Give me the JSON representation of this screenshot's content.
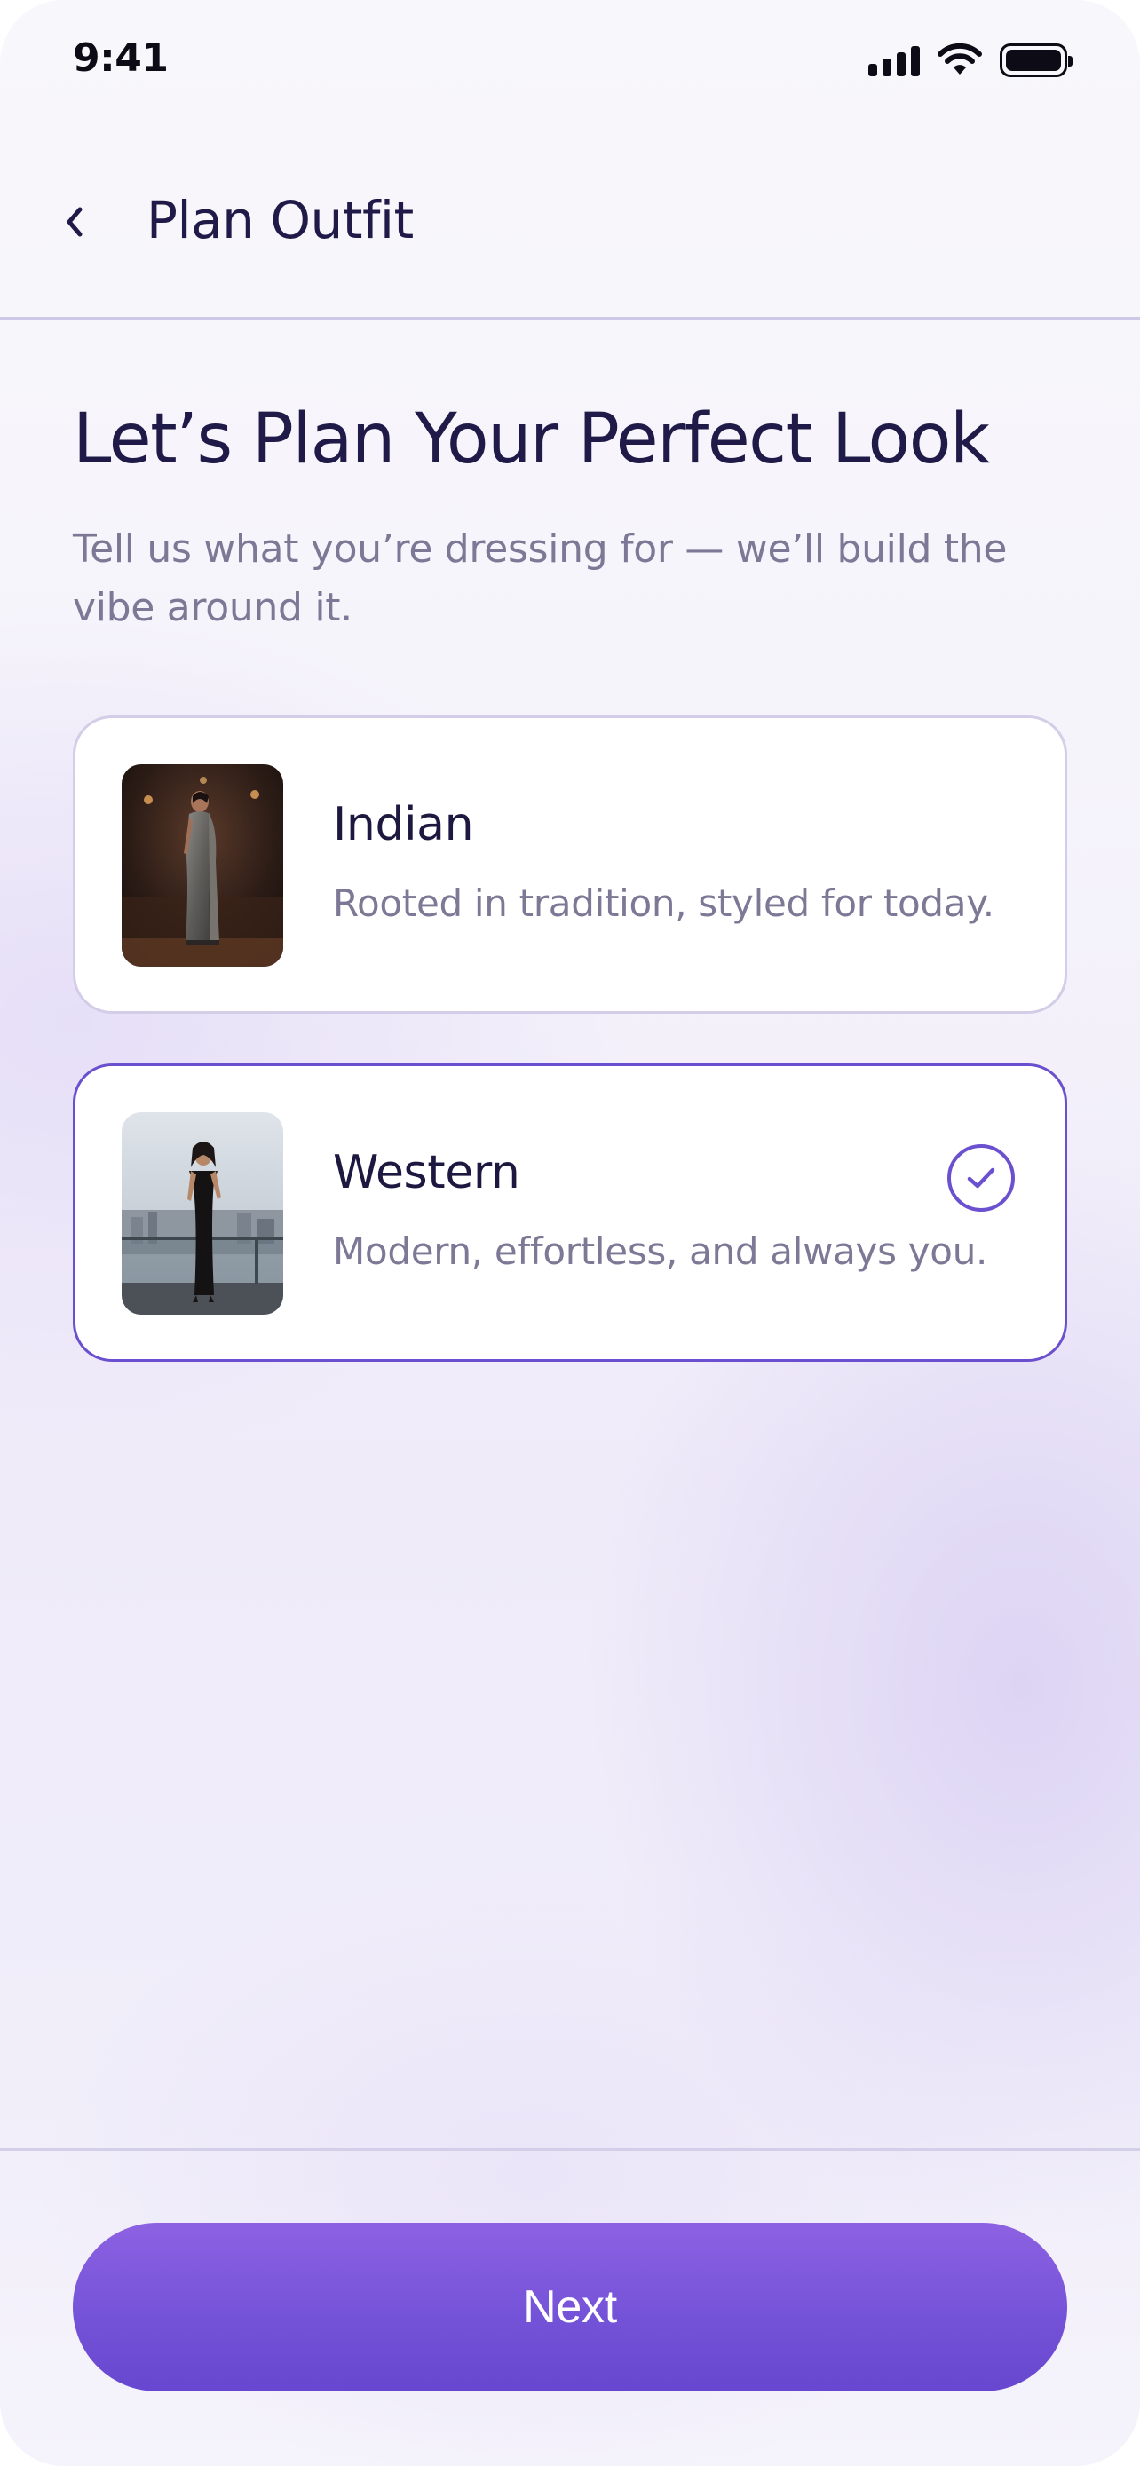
{
  "status_bar": {
    "time": "9:41",
    "icons": [
      "cellular-signal-icon",
      "wifi-icon",
      "battery-icon"
    ]
  },
  "nav": {
    "back_icon": "chevron-left-icon",
    "title": "Plan Outfit"
  },
  "header": {
    "title": "Let’s Plan Your Perfect Look",
    "subtitle": "Tell us what you’re dressing for — we’ll build the vibe around it."
  },
  "options": [
    {
      "id": "indian",
      "title": "Indian",
      "description": "Rooted in tradition, styled for today.",
      "selected": false,
      "thumbnail": "woman-in-saree-photo"
    },
    {
      "id": "western",
      "title": "Western",
      "description": "Modern, effortless, and always you.",
      "selected": true,
      "thumbnail": "woman-in-black-dress-photo",
      "selected_icon": "check-circle-icon"
    }
  ],
  "footer": {
    "next_label": "Next"
  },
  "colors": {
    "accent": "#6b51cf",
    "button_gradient_top": "#8d61e2",
    "button_gradient_bottom": "#6747cf",
    "heading": "#1f1a48",
    "muted_text": "#7d7896",
    "card_border": "#d3cde8"
  }
}
